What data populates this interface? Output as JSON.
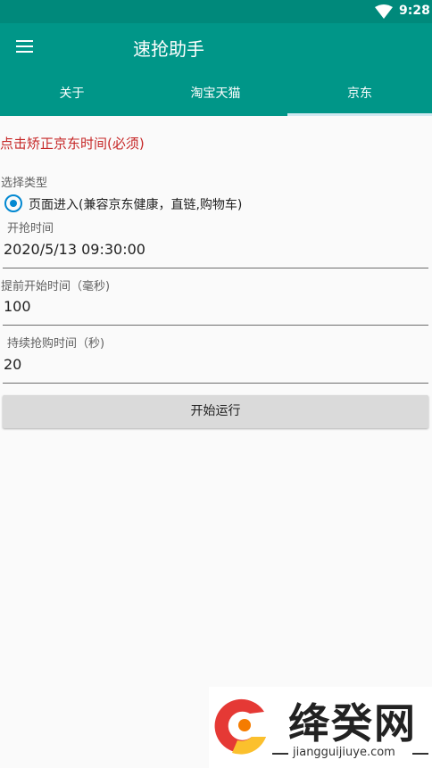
{
  "status_bar": {
    "time": "9:28",
    "icons": [
      "wifi-icon"
    ]
  },
  "toolbar": {
    "title": "速抢助手",
    "menu_icon": "hamburger-menu-icon"
  },
  "tabs": [
    {
      "label": "关于",
      "selected": false
    },
    {
      "label": "淘宝天猫",
      "selected": false
    },
    {
      "label": "京东",
      "selected": true
    }
  ],
  "main": {
    "warning": "点击矫正京东时间(必须)",
    "select_type_label": "选择类型",
    "radio_option": {
      "label": "页面进入(兼容京东健康，直链,购物车)",
      "checked": true
    },
    "start_time_label": "开抢时间",
    "start_time_value": "2020/5/13 09:30:00",
    "advance_label": "提前开始时间（毫秒)",
    "advance_value": "100",
    "duration_label": "持续抢购时间（秒)",
    "duration_value": "20",
    "run_button": "开始运行"
  },
  "watermark": {
    "text": "绛癸网",
    "url": "jiangguijiuye.com"
  },
  "colors": {
    "primary": "#009688",
    "status_bar": "#00897b",
    "accent": "#0288d1",
    "warning": "#c62828"
  }
}
